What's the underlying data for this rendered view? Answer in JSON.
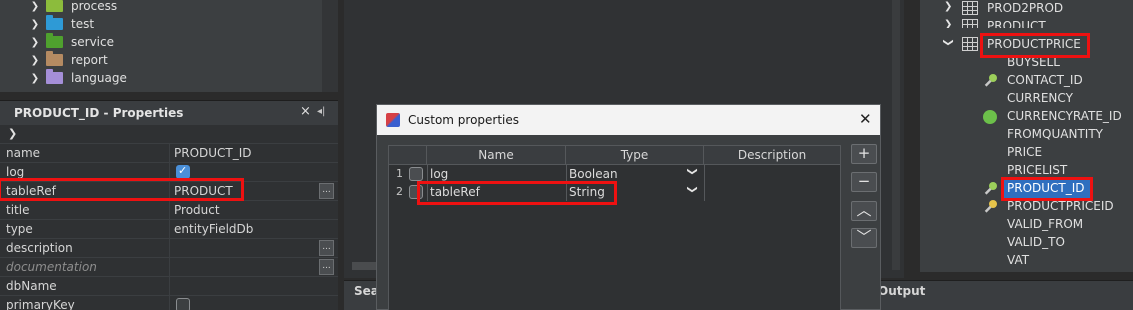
{
  "left_tree": {
    "items": [
      {
        "label": "process",
        "folder_color": "#8cbc3c"
      },
      {
        "label": "test",
        "folder_color": "#2e9ad6"
      },
      {
        "label": "service",
        "folder_color": "#4fa12e"
      },
      {
        "label": "report",
        "folder_color": "#b58b62"
      },
      {
        "label": "language",
        "folder_color": "#a58fd8"
      }
    ]
  },
  "properties": {
    "title": "PRODUCT_ID - Properties",
    "close_icon": "×",
    "pin_icon": "◂|",
    "ellipsis_label": "...",
    "rows": [
      {
        "name": "name",
        "value": "PRODUCT_ID"
      },
      {
        "name": "log",
        "value": ""
      },
      {
        "name": "tableRef",
        "value": "PRODUCT"
      },
      {
        "name": "title",
        "value": "Product"
      },
      {
        "name": "type",
        "value": "entityFieldDb"
      },
      {
        "name": "description",
        "value": ""
      },
      {
        "name": "documentation",
        "value": ""
      },
      {
        "name": "dbName",
        "value": ""
      },
      {
        "name": "primaryKey",
        "value": ""
      }
    ]
  },
  "bottom_tabs": {
    "search_fragment": "Sea",
    "output": "Output"
  },
  "right_tree": {
    "tables": [
      "PROD2PROD",
      "PRODUCT",
      "PRODUCTPRICE"
    ],
    "fields": [
      {
        "label": "BUYSELL",
        "icon": "none"
      },
      {
        "label": "CONTACT_ID",
        "icon": "key-icon"
      },
      {
        "label": "CURRENCY",
        "icon": "none"
      },
      {
        "label": "CURRENCYRATE_ID",
        "icon": "green-dot-icon"
      },
      {
        "label": "FROMQUANTITY",
        "icon": "none"
      },
      {
        "label": "PRICE",
        "icon": "none"
      },
      {
        "label": "PRICELIST",
        "icon": "none"
      },
      {
        "label": "PRODUCT_ID",
        "icon": "key-icon",
        "selected": true
      },
      {
        "label": "PRODUCTPRICEID",
        "icon": "gold-key-icon"
      },
      {
        "label": "VALID_FROM",
        "icon": "none"
      },
      {
        "label": "VALID_TO",
        "icon": "none"
      },
      {
        "label": "VAT",
        "icon": "none"
      }
    ]
  },
  "dialog": {
    "title": "Custom properties",
    "columns": [
      "Name",
      "Type",
      "Description"
    ],
    "rows": [
      {
        "num": "1",
        "name": "log",
        "type": "Boolean",
        "description": ""
      },
      {
        "num": "2",
        "name": "tableRef",
        "type": "String",
        "description": ""
      }
    ],
    "buttons": {
      "add": "+",
      "remove": "−",
      "up": "︿",
      "down": "﹀"
    }
  },
  "colors": {
    "highlight": "#ee1111",
    "selection": "#2f6fbf",
    "checkbox_checked": "#4a8fd8"
  }
}
